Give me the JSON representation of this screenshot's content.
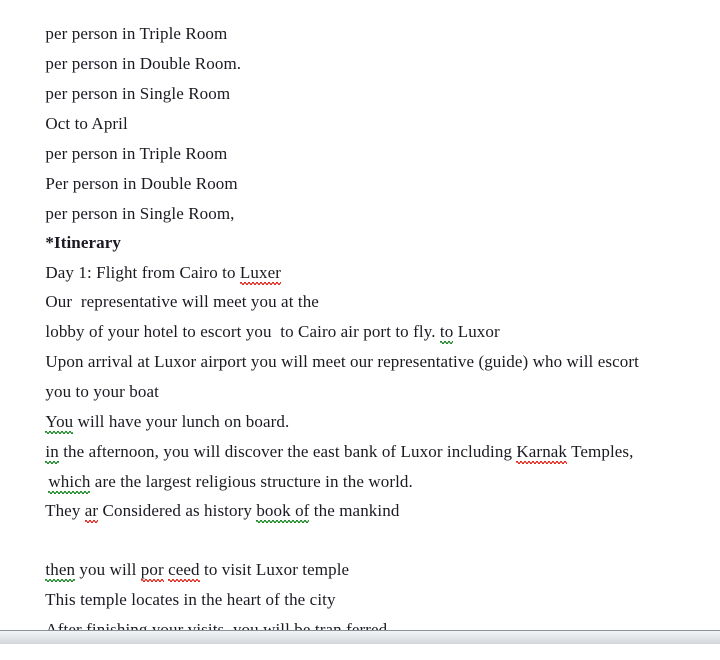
{
  "document": {
    "text_color": "#1a1a22",
    "background_color": "#ffffff",
    "spellcheck_red": "#e02b20",
    "grammarcheck_green": "#1f8b2a",
    "lines": [
      {
        "id": "l1",
        "text": "per person in Triple Room"
      },
      {
        "id": "l2",
        "text": "per person in Double Room."
      },
      {
        "id": "l3",
        "text": "per person in Single Room"
      },
      {
        "id": "l4",
        "text": "Oct to April"
      },
      {
        "id": "l5",
        "text": "per person in Triple Room"
      },
      {
        "id": "l6",
        "text": "Per person in Double Room"
      },
      {
        "id": "l7",
        "text": "per person in Single Room,"
      },
      {
        "id": "l8",
        "text": "*Itinerary"
      },
      {
        "id": "l9a",
        "text": "Day 1: Flight from Cairo to "
      },
      {
        "id": "l9b",
        "text": "Luxer"
      },
      {
        "id": "l10",
        "text": "Our  representative will meet you at the"
      },
      {
        "id": "l11a",
        "text": "lobby of your hotel to escort you  to Cairo air port to fly. "
      },
      {
        "id": "l11b",
        "text": "to"
      },
      {
        "id": "l11c",
        "text": " Luxor"
      },
      {
        "id": "l12",
        "text": "Upon arrival at Luxor airport you will meet our representative (guide) who will escort"
      },
      {
        "id": "l13",
        "text": "you to your boat"
      },
      {
        "id": "l14a",
        "text": "You"
      },
      {
        "id": "l14b",
        "text": " will have your lunch on board."
      },
      {
        "id": "l15a",
        "text": "in"
      },
      {
        "id": "l15b",
        "text": " the afternoon, you will discover the east bank of Luxor including "
      },
      {
        "id": "l15c",
        "text": "Karnak"
      },
      {
        "id": "l15d",
        "text": " Temples,"
      },
      {
        "id": "l16a",
        "text": "which"
      },
      {
        "id": "l16b",
        "text": " are the largest religious structure in the world."
      },
      {
        "id": "l17a",
        "text": "They "
      },
      {
        "id": "l17b",
        "text": "ar"
      },
      {
        "id": "l17c",
        "text": " Considered as history "
      },
      {
        "id": "l17d",
        "text": "book of"
      },
      {
        "id": "l17e",
        "text": " the mankind"
      },
      {
        "id": "l18a",
        "text": "then"
      },
      {
        "id": "l18b",
        "text": " you will "
      },
      {
        "id": "l18c",
        "text": "por"
      },
      {
        "id": "l18d",
        "text": " "
      },
      {
        "id": "l18e",
        "text": "ceed"
      },
      {
        "id": "l18f",
        "text": " to visit Luxor temple"
      },
      {
        "id": "l19",
        "text": "This temple locates in the heart of the city"
      },
      {
        "id": "l20a",
        "text": "After"
      },
      {
        "id": "l20b",
        "text": " finishing your visits, you will be "
      },
      {
        "id": "l20c",
        "text": "tran"
      },
      {
        "id": "l20d",
        "text": " "
      },
      {
        "id": "l20e",
        "text": "ferred"
      }
    ]
  }
}
